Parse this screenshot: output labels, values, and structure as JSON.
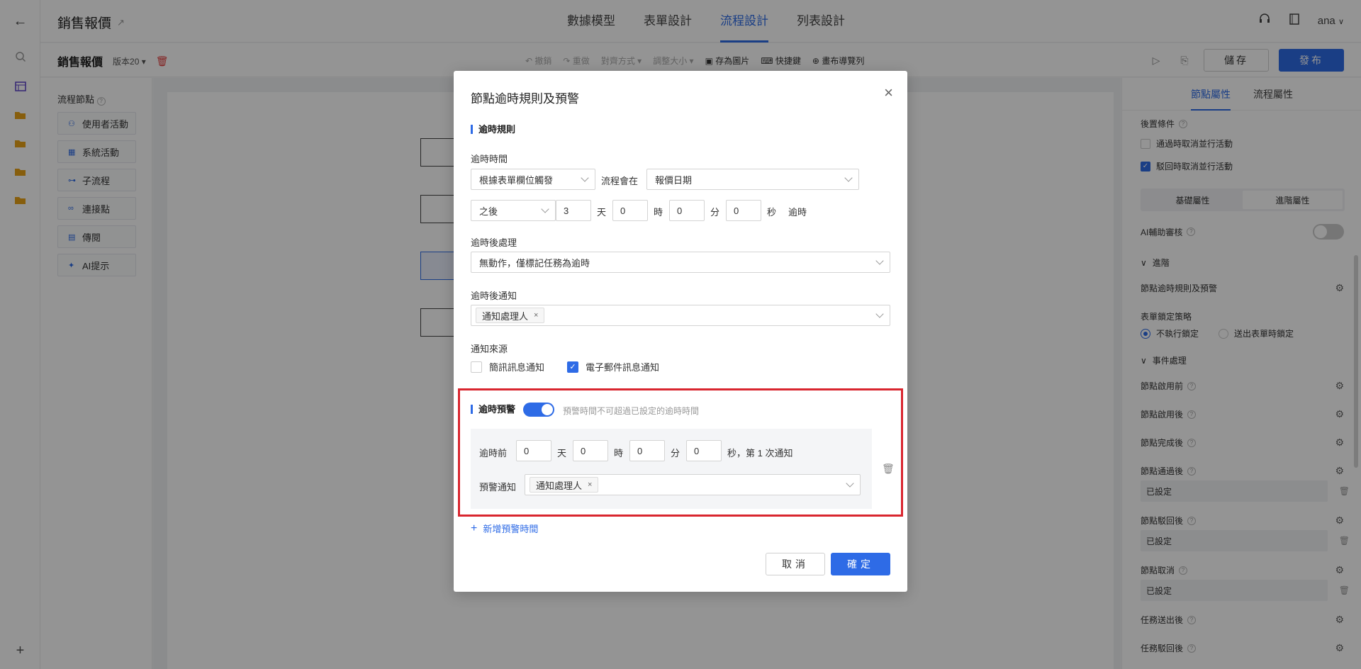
{
  "app": {
    "title": "銷售報價",
    "tabs": [
      "數據模型",
      "表單設計",
      "流程設計",
      "列表設計"
    ],
    "active_tab": 2,
    "user": "ana"
  },
  "toolbar": {
    "doc_title": "銷售報價",
    "version": "版本20",
    "items": [
      "撤銷",
      "重做",
      "對齊方式",
      "調整大小",
      "存為圖片",
      "快捷鍵",
      "畫布導覽列"
    ],
    "save_label": "儲存",
    "publish_label": "發布"
  },
  "left_panel": {
    "title": "流程節點",
    "items": [
      {
        "label": "使用者活動",
        "icon": "user-icon"
      },
      {
        "label": "系統活動",
        "icon": "grid-icon"
      },
      {
        "label": "子流程",
        "icon": "subflow-icon"
      },
      {
        "label": "連接點",
        "icon": "link-icon"
      },
      {
        "label": "傳閱",
        "icon": "doc-icon"
      },
      {
        "label": "AI提示",
        "icon": "ai-icon"
      }
    ]
  },
  "right_panel": {
    "tabs": [
      "節點屬性",
      "流程屬性"
    ],
    "post_condition": "後置條件",
    "cb_pass": "通過時取消並行活動",
    "cb_reject": "駁回時取消並行活動",
    "seg": [
      "基礎屬性",
      "進階屬性"
    ],
    "ai_review": "AI輔助審核",
    "advanced": "進階",
    "timeout_rule": "節點逾時規則及預警",
    "lock_strategy": "表單鎖定策略",
    "lock_opts": [
      "不執行鎖定",
      "送出表單時鎖定"
    ],
    "event_handling": "事件處理",
    "events": {
      "before_enable": "節點啟用前",
      "after_enable": "節點啟用後",
      "after_complete": "節點完成後",
      "after_pass": "節點通過後",
      "after_reject": "節點駁回後",
      "cancel": "節點取消",
      "after_submit": "任務送出後",
      "after_task_reject": "任務駁回後"
    },
    "configured": "已設定"
  },
  "dialog": {
    "title": "節點逾時規則及預警",
    "sec_rule": "逾時規則",
    "time_label": "逾時時間",
    "trigger": "根據表單欄位觸發",
    "flow_will": "流程會在",
    "date_field": "報價日期",
    "after": "之後",
    "days": "3",
    "hours": "0",
    "minutes": "0",
    "seconds": "0",
    "u_day": "天",
    "u_hour": "時",
    "u_min": "分",
    "u_sec": "秒",
    "timeout_word": "逾時",
    "handle_label": "逾時後處理",
    "handle_value": "無動作，僅標記任務為逾時",
    "notify_label": "逾時後通知",
    "notify_tag": "通知處理人",
    "source_label": "通知來源",
    "src_sms": "簡訊訊息通知",
    "src_email": "電子郵件訊息通知",
    "sec_warn": "逾時預警",
    "warn_hint": "預警時間不可超過已設定的逾時時間",
    "before_label": "逾時前",
    "w_days": "0",
    "w_hours": "0",
    "w_minutes": "0",
    "w_seconds": "0",
    "w_suffix": "秒，第 1 次通知",
    "warn_notify_label": "預警通知",
    "warn_tag": "通知處理人",
    "add_warn": "新增預警時間",
    "cancel": "取消",
    "ok": "確定"
  },
  "colors": {
    "accent": "#2e6be6",
    "highlight_frame": "#d9262f"
  }
}
